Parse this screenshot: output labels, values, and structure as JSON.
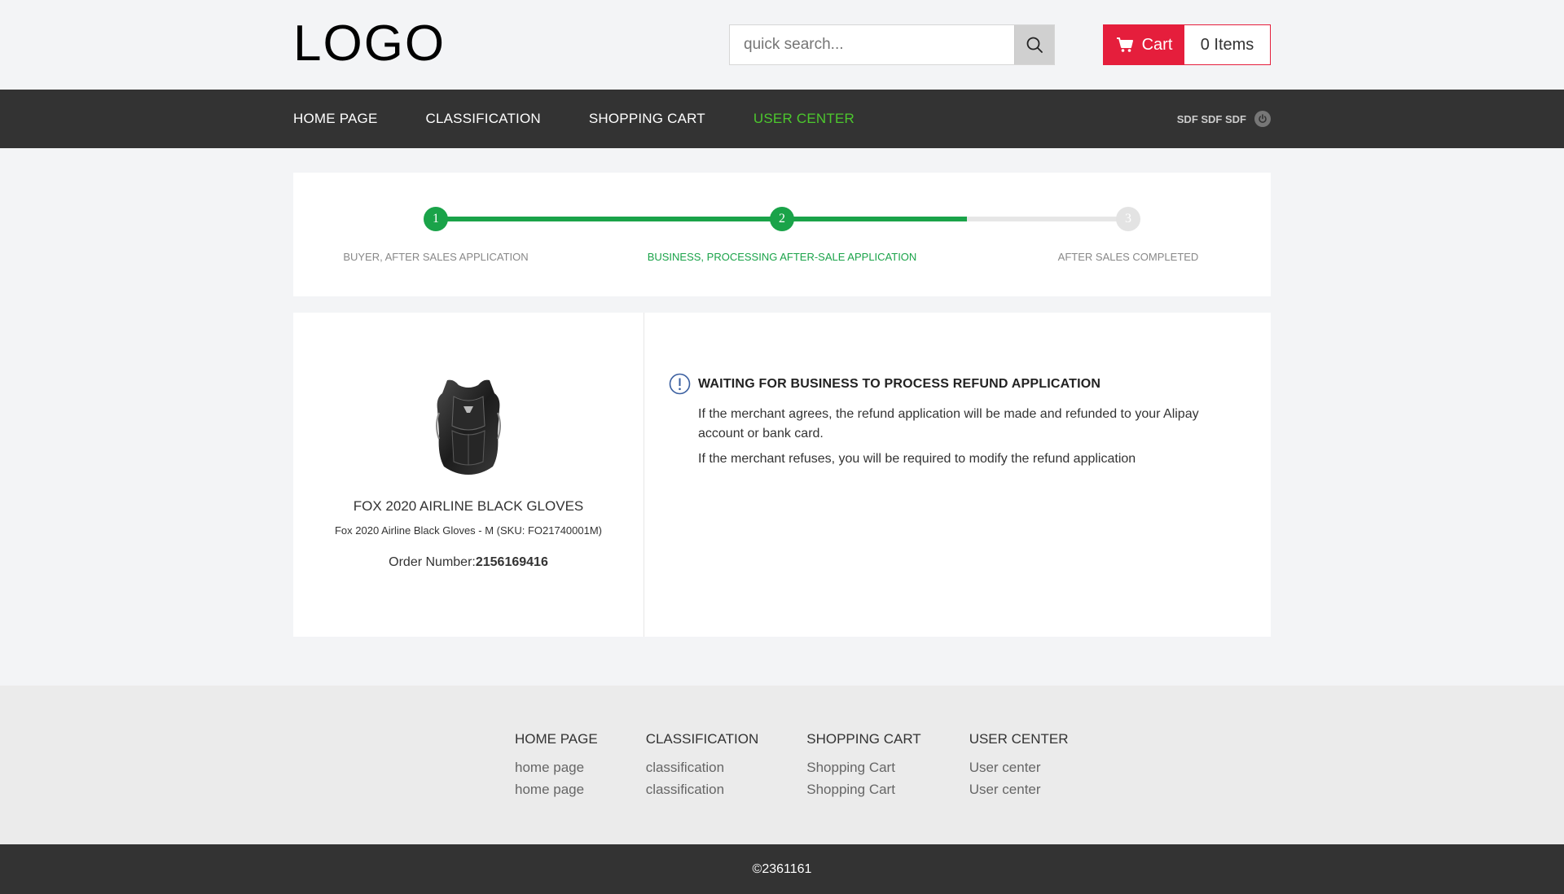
{
  "header": {
    "logo": "LOGO",
    "search_placeholder": "quick search...",
    "cart_label": "Cart",
    "cart_count": "0 Items"
  },
  "nav": {
    "items": [
      {
        "label": "HOME PAGE"
      },
      {
        "label": "CLASSIFICATION"
      },
      {
        "label": "SHOPPING CART"
      },
      {
        "label": "USER CENTER"
      }
    ],
    "active_index": 3,
    "user": "SDF SDF SDF"
  },
  "steps": [
    {
      "number": "1",
      "label": "BUYER, AFTER SALES APPLICATION"
    },
    {
      "number": "2",
      "label": "BUSINESS, PROCESSING AFTER-SALE APPLICATION"
    },
    {
      "number": "3",
      "label": "AFTER SALES COMPLETED"
    }
  ],
  "product": {
    "name": "FOX 2020 AIRLINE BLACK GLOVES",
    "sku_line": "Fox 2020 Airline Black Gloves - M (SKU: FO21740001M)",
    "order_label": "Order Number:",
    "order_number": "2156169416"
  },
  "status": {
    "title": "WAITING FOR BUSINESS TO PROCESS REFUND APPLICATION",
    "line1": "If the merchant agrees, the refund application will be made and refunded to your Alipay account or bank card.",
    "line2": "If the merchant refuses, you will be required to modify the refund application"
  },
  "footer": {
    "columns": [
      {
        "title": "HOME PAGE",
        "links": [
          "home page",
          "home page"
        ]
      },
      {
        "title": "CLASSIFICATION",
        "links": [
          "classification",
          "classification"
        ]
      },
      {
        "title": "SHOPPING CART",
        "links": [
          "Shopping Cart",
          "Shopping Cart"
        ]
      },
      {
        "title": "USER CENTER",
        "links": [
          "User center",
          "User center"
        ]
      }
    ],
    "copyright": "©2361161"
  },
  "colors": {
    "accent_green": "#1aa349",
    "nav_active": "#4cc82d",
    "cart_red": "#e51e3c"
  }
}
